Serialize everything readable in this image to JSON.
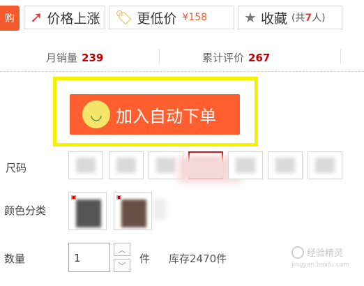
{
  "topbar": {
    "buy_icon_text": "购",
    "price_up_label": "价格上涨",
    "lower_price_label": "更低价",
    "lower_price_value": "¥158",
    "favorite_label": "收藏",
    "favorite_count_prefix": "(共",
    "favorite_count": "7",
    "favorite_count_suffix": "人)",
    "icons": {
      "price_up": "arrow-up-right-icon",
      "lower_price": "price-tag-icon",
      "favorite": "star-icon"
    }
  },
  "stats": {
    "monthly_sales_label": "月销量",
    "monthly_sales_value": "239",
    "reviews_label": "累计评价",
    "reviews_value": "267"
  },
  "auto_order": {
    "label": "加入自动下单",
    "highlight_color": "#f3f300",
    "button_color": "#ff5f2e"
  },
  "size": {
    "label": "尺码",
    "selected_index": 3
  },
  "color": {
    "label": "颜色分类"
  },
  "quantity": {
    "label": "数量",
    "value": "1",
    "unit": "件",
    "stock": "库存2470件"
  },
  "watermark": {
    "text": "经验精灵",
    "sub": "jingyan.baidu.com"
  }
}
